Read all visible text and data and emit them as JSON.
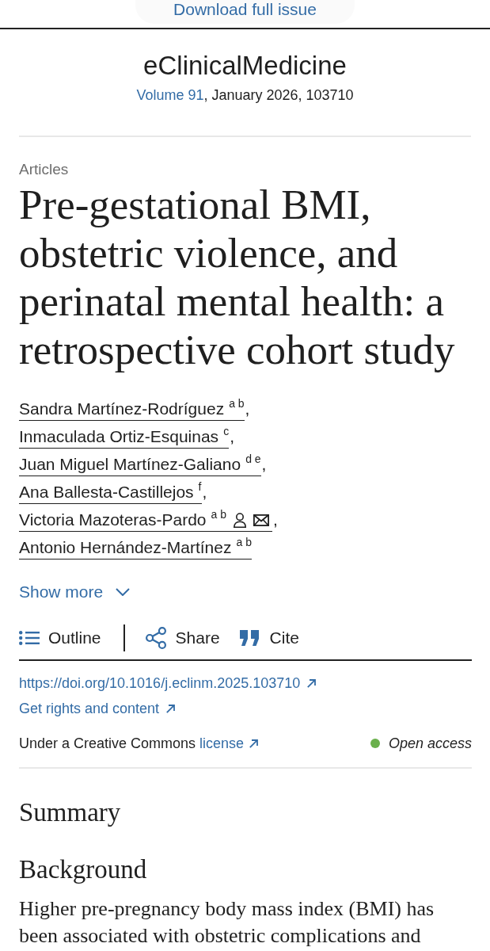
{
  "top_bar": {
    "download_button": "Download full issue"
  },
  "journal": {
    "name": "eClinicalMedicine",
    "volume_link": "Volume 91",
    "issue_details": ", January 2026, 103710"
  },
  "article": {
    "type": "Articles",
    "title": "Pre-gestational BMI, obstetric violence, and perinatal mental health: a retrospective cohort study"
  },
  "authors": [
    {
      "name": "Sandra Martínez-Rodríguez",
      "affiliations": "a b",
      "corresponding": false,
      "separator": ","
    },
    {
      "name": "Inmaculada Ortiz-Esquinas",
      "affiliations": "c",
      "corresponding": false,
      "separator": ","
    },
    {
      "name": "Juan Miguel Martínez-Galiano",
      "affiliations": "d e",
      "corresponding": false,
      "separator": ","
    },
    {
      "name": "Ana Ballesta-Castillejos",
      "affiliations": "f",
      "corresponding": false,
      "separator": ","
    },
    {
      "name": "Victoria Mazoteras-Pardo",
      "affiliations": "a b",
      "corresponding": true,
      "separator": ","
    },
    {
      "name": "Antonio Hernández-Martínez",
      "affiliations": "a b",
      "corresponding": false
    }
  ],
  "show_more": "Show more",
  "toolbar": {
    "outline_button": "Outline",
    "actions": [
      {
        "kind": "share",
        "label": "Share"
      },
      {
        "kind": "cite",
        "label": "Cite"
      }
    ]
  },
  "links": {
    "doi": "https://doi.org/10.1016/j.eclinm.2025.103710",
    "rights": "Get rights and content"
  },
  "license": {
    "text": "Under a Creative Commons",
    "link": "license"
  },
  "open_access": {
    "label": "Open access"
  },
  "abstract": {
    "heading": "Summary",
    "sections": [
      {
        "heading": "Background",
        "text": "Higher pre-pregnancy body mass index (BMI) has been associated with obstetric complications and"
      }
    ]
  }
}
